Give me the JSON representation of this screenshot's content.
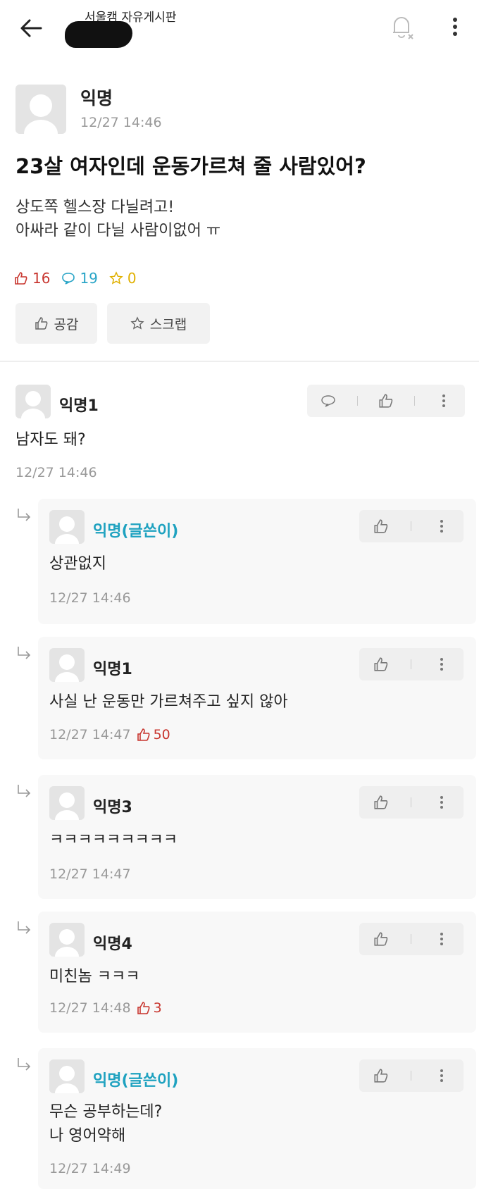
{
  "header": {
    "board_title": "서울캠 자유게시판"
  },
  "post": {
    "author": "익명",
    "time": "12/27 14:46",
    "title": "23살 여자인데 운동가르쳐 줄 사람있어?",
    "body": "상도쪽 헬스장 다닐려고!\n아싸라 같이 다닐 사람이없어  ㅠ",
    "likes": "16",
    "comments": "19",
    "scraps": "0",
    "empathy_label": "공감",
    "scrap_label": "스크랩"
  },
  "comments": [
    {
      "author": "익명1",
      "body": "남자도 돼?",
      "time": "12/27 14:46",
      "likes": ""
    },
    {
      "author": "익명(글쓴이)",
      "body": "상관없지",
      "time": "12/27 14:46",
      "likes": ""
    },
    {
      "author": "익명1",
      "body": "사실 난 운동만 가르쳐주고 싶지 않아",
      "time": "12/27 14:47",
      "likes": "50"
    },
    {
      "author": "익명3",
      "body": "ㅋㅋㅋㅋㅋㅋㅋㅋㅋ",
      "time": "12/27 14:47",
      "likes": ""
    },
    {
      "author": "익명4",
      "body": "미친놈 ㅋㅋㅋ",
      "time": "12/27 14:48",
      "likes": "3"
    },
    {
      "author": "익명(글쓴이)",
      "body": "무슨 공부하는데?\n나 영어약해",
      "time": "12/27 14:49",
      "likes": ""
    }
  ],
  "colors": {
    "accent_writer": "#1fa2c0",
    "like_red": "#c8362f",
    "comment_blue": "#2aa5c7",
    "scrap_yellow": "#e0b000"
  }
}
